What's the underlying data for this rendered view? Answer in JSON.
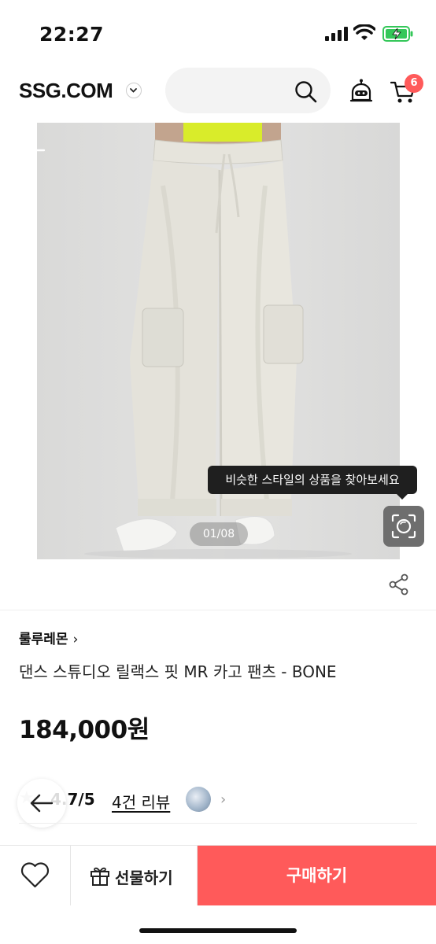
{
  "status_bar": {
    "time": "22:27"
  },
  "header": {
    "logo": "SSG.COM",
    "cart_count": "6"
  },
  "gallery": {
    "tooltip": "비슷한 스타일의 상품을 찾아보세요",
    "pager": "01/08"
  },
  "product": {
    "brand": "룰루레몬",
    "brand_chevron": "›",
    "title": "댄스 스튜디오 릴랙스 핏 MR 카고 팬츠 - BONE",
    "price": "184,000원",
    "star": "★",
    "rating": "4.7/5",
    "review_count": "4건 리뷰",
    "review_chevron": "›"
  },
  "bottom_bar": {
    "gift_label": "선물하기",
    "buy_label": "구매하기"
  },
  "colors": {
    "accent": "#ff5a5a",
    "dark": "#1f1f1f"
  }
}
